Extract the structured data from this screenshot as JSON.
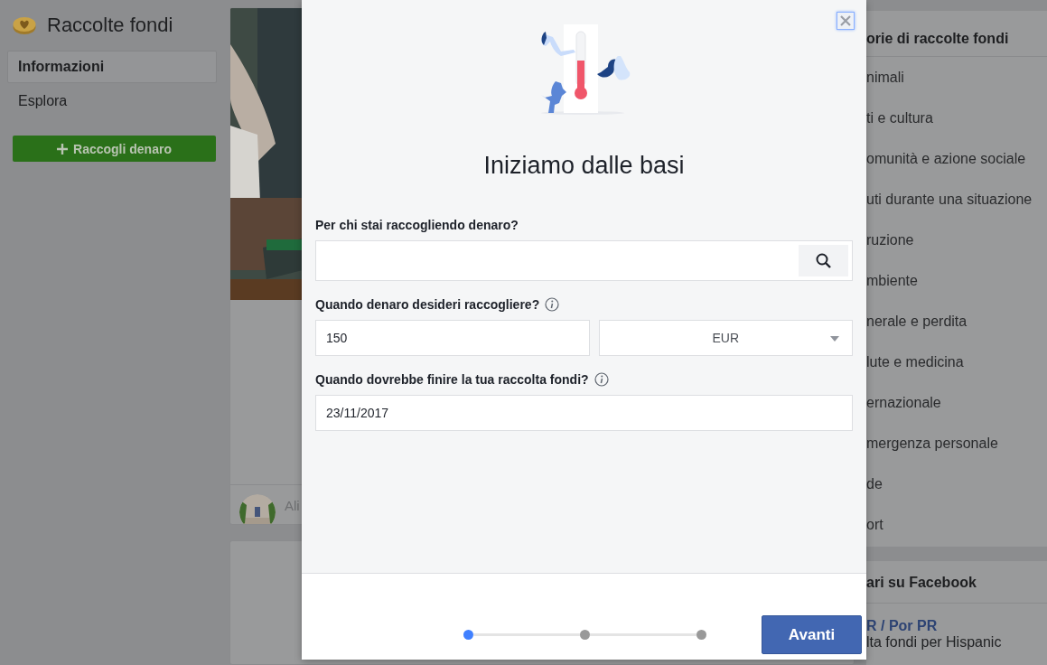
{
  "sidebar": {
    "title": "Raccolte fondi",
    "items": [
      {
        "label": "Informazioni",
        "selected": true
      },
      {
        "label": "Esplora",
        "selected": false
      }
    ],
    "button": "Raccogli denaro"
  },
  "feed": {
    "cards": [
      {
        "kind": "picture",
        "author": "Ali"
      },
      {
        "kind": "blank"
      }
    ]
  },
  "categories": {
    "title": "orie di raccolte fondi",
    "items": [
      "nimali",
      "ti e cultura",
      "omunità e azione sociale",
      "uti durante una situazione",
      "ruzione",
      "mbiente",
      "nerale e perdita",
      "lute e medicina",
      "ernazionale",
      "mergenza personale",
      "de",
      "ort"
    ]
  },
  "popular": {
    "title": "ari su Facebook",
    "link": "R / Por PR",
    "text": "lta fondi per Hispanic"
  },
  "dialog": {
    "title": "Iniziamo dalle basi",
    "fields": [
      {
        "kind": "search",
        "label": "Per chi stai raccogliendo denaro?",
        "info": false
      },
      {
        "kind": "amount",
        "label": "Quando denaro desideri raccogliere?",
        "info": true,
        "value": "150",
        "currency": "EUR"
      },
      {
        "kind": "date",
        "label": "Quando dovrebbe finire la tua raccolta fondi?",
        "info": true,
        "value": "23/11/2017"
      }
    ],
    "steps": [
      {
        "selected": true
      },
      {
        "selected": false
      },
      {
        "selected": false
      }
    ],
    "button": "Avanti"
  }
}
